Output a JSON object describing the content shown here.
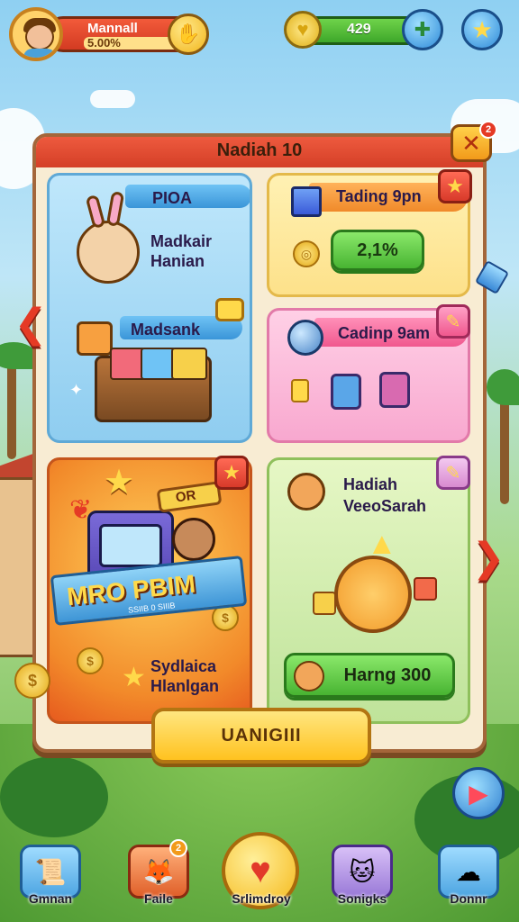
{
  "player": {
    "name": "Mannall",
    "xp_text": "5.00%"
  },
  "currency": {
    "value": "429"
  },
  "panel": {
    "title": "Nadiah 10",
    "close_badge_count": "2"
  },
  "cards": {
    "top_left": {
      "tag": "PIOA",
      "line1": "Madkair",
      "line2": "Hanian",
      "sub_tag": "Madsank"
    },
    "top_right": {
      "title": "Tading 9pn",
      "button": "2,1%"
    },
    "mid_right": {
      "title": "Cadinp 9am"
    },
    "bottom_left": {
      "chip": "OR",
      "banner": "MRO PBIM",
      "banner_sub": "SSIIB 0 SIIIB",
      "line1": "Sydlaica",
      "line2": "Hlanlgan"
    },
    "bottom_right": {
      "line1": "Hadiah",
      "line2": "VeeoSarah",
      "button": "Harng 300"
    }
  },
  "main_button": "UANIGIII",
  "bottom_nav": {
    "items": [
      {
        "label": "Gmnan",
        "icon": "scroll-icon"
      },
      {
        "label": "Faile",
        "icon": "fox-icon",
        "badge": "2"
      },
      {
        "label": "Srlimdroy",
        "icon": "heart-icon"
      },
      {
        "label": "Sonigks",
        "icon": "cat-icon"
      },
      {
        "label": "Donnr",
        "icon": "cloud-icon"
      }
    ]
  },
  "colors": {
    "accent_red": "#e53a25",
    "accent_yellow": "#ffc21f",
    "accent_green": "#48b432"
  }
}
